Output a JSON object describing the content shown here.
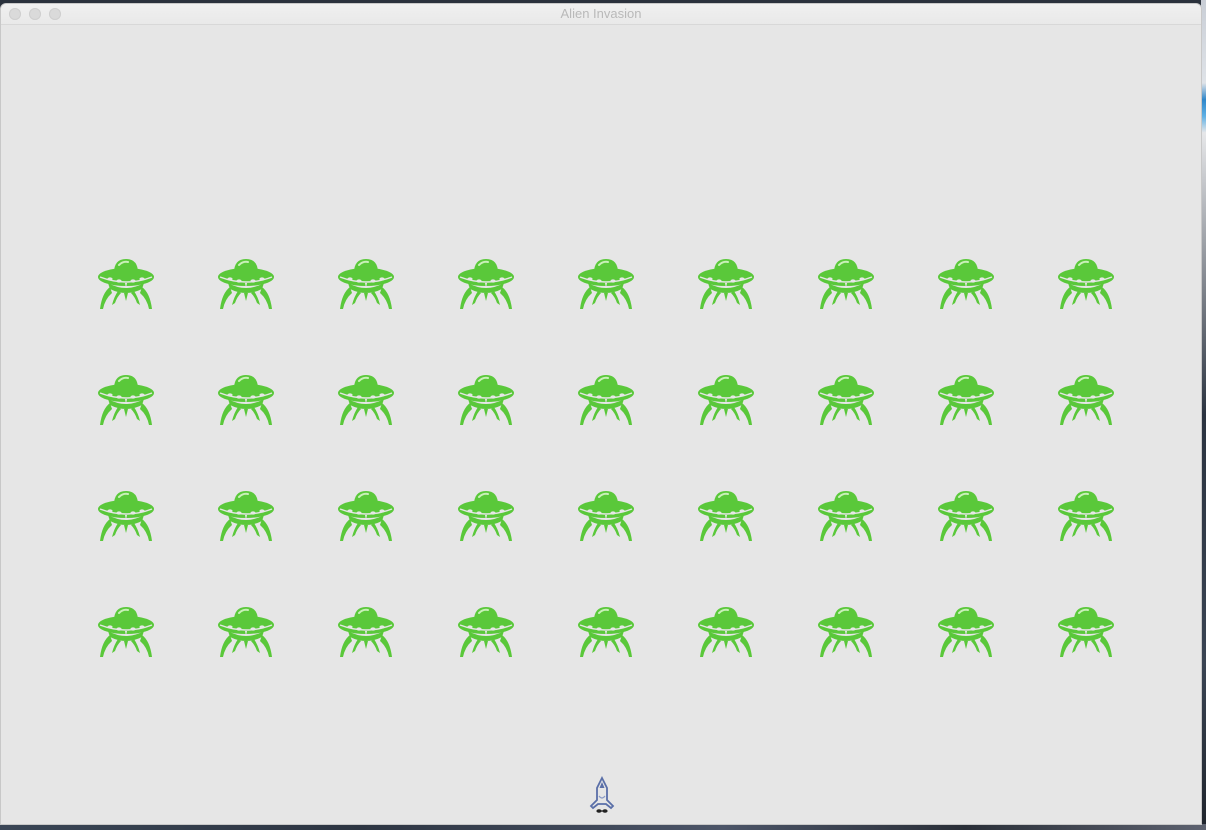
{
  "window": {
    "title": "Alien Invasion"
  },
  "game": {
    "background_color": "#e6e6e6",
    "alien_color": "#5ac83a",
    "ship_color": "#5a6fa8",
    "fleet": {
      "rows": 4,
      "columns": 9,
      "alien_icon": "ufo-alien-icon"
    },
    "player_ship_icon": "rocket-ship-icon"
  }
}
